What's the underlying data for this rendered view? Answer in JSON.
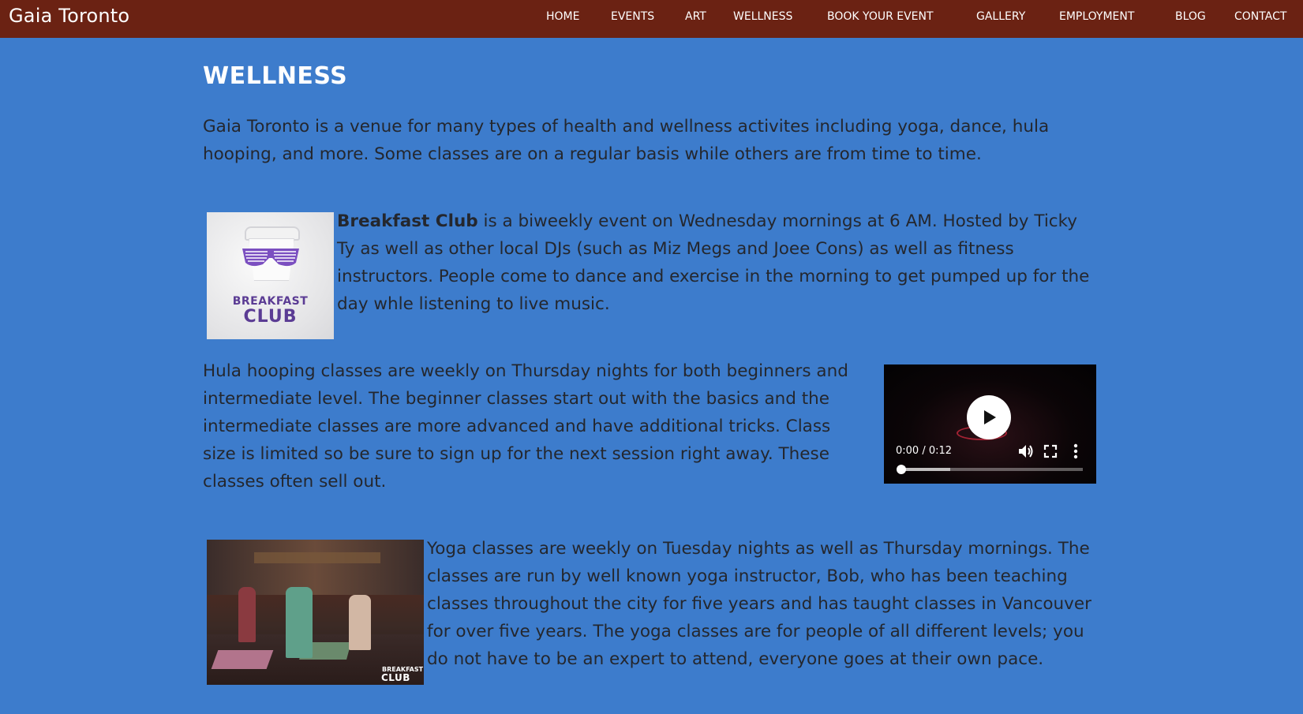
{
  "site": {
    "brand": "Gaia Toronto"
  },
  "nav": {
    "items": [
      {
        "label": "HOME"
      },
      {
        "label": "EVENTS"
      },
      {
        "label": "ART"
      },
      {
        "label": "WELLNESS"
      },
      {
        "label": "BOOK YOUR EVENT"
      },
      {
        "label": "GALLERY"
      },
      {
        "label": "EMPLOYMENT"
      },
      {
        "label": "BLOG"
      },
      {
        "label": "CONTACT"
      }
    ]
  },
  "page": {
    "title": "WELLNESS",
    "intro": "Gaia Toronto is a venue for many types of health and wellness activites including yoga, dance, hula hooping, and more. Some classes are on a regular basis while others are from time to time.",
    "breakfast_club": {
      "name": "Breakfast Club",
      "text": " is a biweekly event on Wednesday mornings at 6 AM. Hosted by Ticky Ty as well as other local DJs (such as Miz Megs and Joee Cons) as well as fitness instructors. People come to dance and exercise in the morning to get pumped up for the day whle listening to live music.",
      "logo_line1": "BREAKFAST",
      "logo_line2": "CLUB"
    },
    "hula": {
      "text": "Hula hooping classes are weekly on Thursday nights for both beginners and intermediate level. The beginner classes start out with the basics and the intermediate classes are more advanced and have additional tricks. Class size is limited so be sure to sign up for the next session right away. These classes often sell out.",
      "video": {
        "time": "0:00 / 0:12",
        "progress": 0.0,
        "buffered": 0.27
      }
    },
    "yoga": {
      "text": "Yoga classes are weekly on Tuesday nights as well as Thursday mornings. The classes are run by well known yoga instructor, Bob, who has been teaching classes throughout the city for five years and has taught classes in Vancouver for over five years. The yoga classes are for people of all different levels; you do not have to be an expert to attend, everyone goes at their own pace.",
      "photo_watermark_line1": "BREAKFAST",
      "photo_watermark_line2": "CLUB"
    }
  },
  "colors": {
    "background": "#3d7ccc",
    "navbar": "#6b2213",
    "text": "#24272e",
    "title": "#ffffff"
  }
}
